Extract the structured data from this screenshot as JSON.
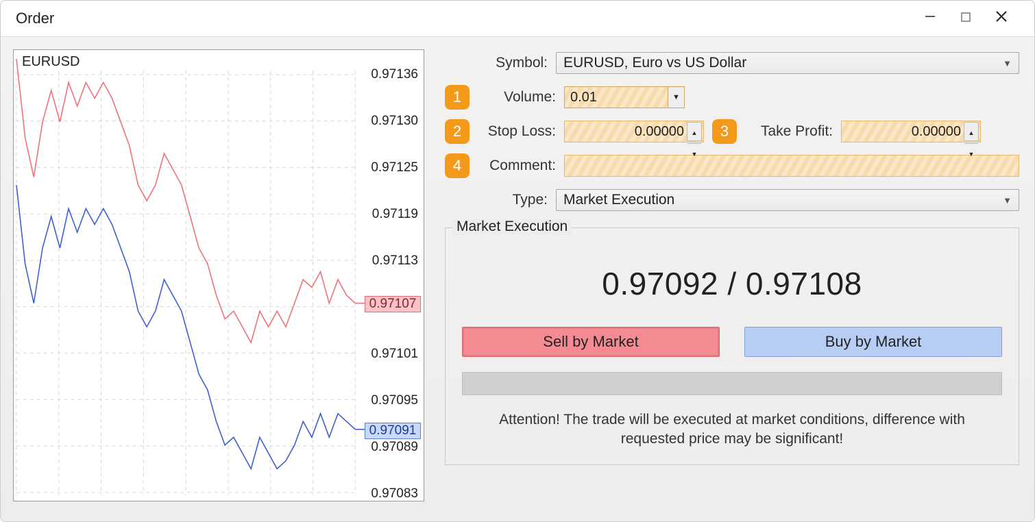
{
  "window": {
    "title": "Order"
  },
  "chart": {
    "symbol": "EURUSD",
    "y_ticks": [
      "0.97136",
      "0.97130",
      "0.97125",
      "0.97119",
      "0.97113",
      "0.97107",
      "0.97101",
      "0.97095",
      "0.97089",
      "0.97083"
    ],
    "bid_tag": "0.97091",
    "ask_tag": "0.97107",
    "tag_indices": {
      "ask": 5,
      "bid": 8.6
    }
  },
  "form": {
    "symbol_label": "Symbol:",
    "symbol_value": "EURUSD, Euro vs US Dollar",
    "volume_label": "Volume:",
    "volume_value": "0.01",
    "stoploss_label": "Stop Loss:",
    "stoploss_value": "0.00000",
    "takeprofit_label": "Take Profit:",
    "takeprofit_value": "0.00000",
    "comment_label": "Comment:",
    "comment_value": "",
    "type_label": "Type:",
    "type_value": "Market Execution",
    "badges": {
      "volume": "1",
      "stoploss": "2",
      "takeprofit": "3",
      "comment": "4"
    }
  },
  "market": {
    "legend": "Market Execution",
    "price_text": "0.97092 / 0.97108",
    "sell_label": "Sell by Market",
    "buy_label": "Buy by Market",
    "attention": "Attention! The trade will be executed at market conditions, difference with requested price may be significant!"
  },
  "chart_data": {
    "type": "line",
    "title": "EURUSD",
    "ylabel": "",
    "ylim": [
      0.97083,
      0.9714
    ],
    "series": [
      {
        "name": "Ask (red)",
        "current": 0.97107,
        "values": [
          0.97138,
          0.97128,
          0.97123,
          0.9713,
          0.97134,
          0.9713,
          0.97135,
          0.97132,
          0.97135,
          0.97133,
          0.97135,
          0.97133,
          0.9713,
          0.97127,
          0.97122,
          0.9712,
          0.97122,
          0.97126,
          0.97124,
          0.97122,
          0.97118,
          0.97114,
          0.97112,
          0.97108,
          0.97105,
          0.97106,
          0.97104,
          0.97102,
          0.97106,
          0.97104,
          0.97106,
          0.97104,
          0.97107,
          0.9711,
          0.97109,
          0.97111,
          0.97107,
          0.9711,
          0.97108,
          0.97107
        ]
      },
      {
        "name": "Bid (blue)",
        "current": 0.97091,
        "values": [
          0.97122,
          0.97112,
          0.97107,
          0.97114,
          0.97118,
          0.97114,
          0.97119,
          0.97116,
          0.97119,
          0.97117,
          0.97119,
          0.97117,
          0.97114,
          0.97111,
          0.97106,
          0.97104,
          0.97106,
          0.9711,
          0.97108,
          0.97106,
          0.97102,
          0.97098,
          0.97096,
          0.97092,
          0.97089,
          0.9709,
          0.97088,
          0.97086,
          0.9709,
          0.97088,
          0.97086,
          0.97087,
          0.97089,
          0.97092,
          0.9709,
          0.97093,
          0.9709,
          0.97093,
          0.97092,
          0.97091
        ]
      }
    ]
  }
}
